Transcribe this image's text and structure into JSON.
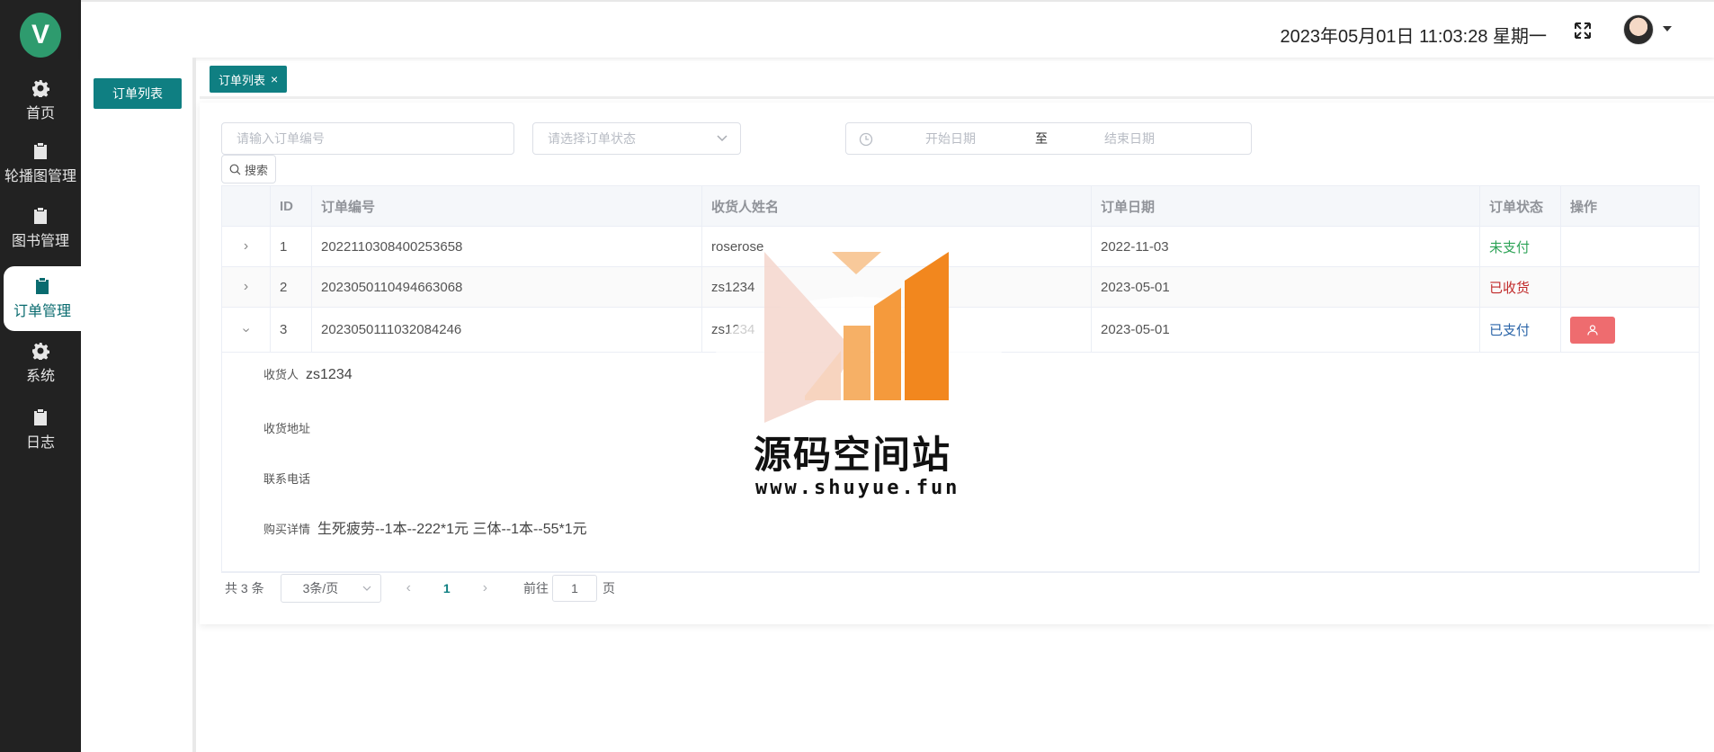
{
  "brand": {
    "logo_letter": "V"
  },
  "sidebar": {
    "items": [
      {
        "label": "首页",
        "icon": "gear-icon"
      },
      {
        "label": "轮播图管理",
        "icon": "clipboard-icon"
      },
      {
        "label": "图书管理",
        "icon": "clipboard-icon"
      },
      {
        "label": "订单管理",
        "icon": "clipboard-icon",
        "active": true
      },
      {
        "label": "系统",
        "icon": "gear-icon"
      },
      {
        "label": "日志",
        "icon": "clipboard-icon"
      }
    ]
  },
  "header": {
    "datetime": "2023年05月01日 11:03:28 星期一"
  },
  "subpanel": {
    "button_label": "订单列表"
  },
  "tabs": [
    {
      "label": "订单列表",
      "close": "×"
    }
  ],
  "filters": {
    "order_placeholder": "请输入订单编号",
    "status_placeholder": "请选择订单状态",
    "date_start": "开始日期",
    "date_sep": "至",
    "date_end": "结束日期",
    "search_label": "搜索"
  },
  "table": {
    "headers": [
      "ID",
      "订单编号",
      "收货人姓名",
      "订单日期",
      "订单状态",
      "操作"
    ],
    "rows": [
      {
        "id": "1",
        "order_no": "2022110308400253658",
        "receiver": "roserose",
        "date": "2022-11-03",
        "status": "未支付"
      },
      {
        "id": "2",
        "order_no": "2023050110494663068",
        "receiver": "zs1234",
        "date": "2023-05-01",
        "status": "已收货"
      },
      {
        "id": "3",
        "order_no": "2023050111032084246",
        "receiver": "zs1234",
        "date": "2023-05-01",
        "status": "已支付"
      }
    ],
    "expanded": {
      "receiver_label": "收货人",
      "receiver_value": "zs1234",
      "address_label": "收货地址",
      "phone_label": "联系电话",
      "detail_label": "购买详情",
      "detail_value": "生死疲劳--1本--222*1元 三体--1本--55*1元"
    }
  },
  "pagination": {
    "total": "共 3 条",
    "page_size": "3条/页",
    "current": "1",
    "goto_label": "前往",
    "goto_value": "1",
    "page_word": "页"
  },
  "watermark": {
    "title": "源码空间站",
    "url": "www.shuyue.fun"
  },
  "colors": {
    "accent": "#0f7f82",
    "sidebar_bg": "#222222",
    "danger": "#ee6c6f"
  }
}
